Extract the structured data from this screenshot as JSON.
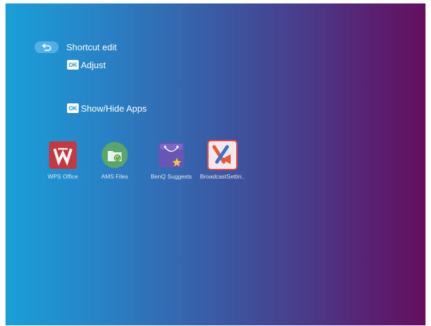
{
  "header": {
    "back_icon": "undo-arrow-icon",
    "title": "Shortcut edit"
  },
  "hints": {
    "adjust": {
      "key": "OK",
      "label": "Adjust"
    },
    "show_hide": {
      "key": "OK",
      "label": "Show/Hide Apps"
    }
  },
  "apps": [
    {
      "label": "WPS Office",
      "icon": "wps-office-icon",
      "color": "#c7373f"
    },
    {
      "label": "AMS Files",
      "icon": "ams-files-icon",
      "color": "#5aa56b"
    },
    {
      "label": "BenQ Suggests",
      "icon": "benq-suggests-icon",
      "color": "#6a55b5"
    },
    {
      "label": "BroadcastSettin..",
      "icon": "broadcast-settings-icon",
      "color": "#e45a3a"
    }
  ],
  "colors": {
    "gradient_start": "#1a9fd8",
    "gradient_end": "#640f5e",
    "focus_outline": "#e24747"
  }
}
